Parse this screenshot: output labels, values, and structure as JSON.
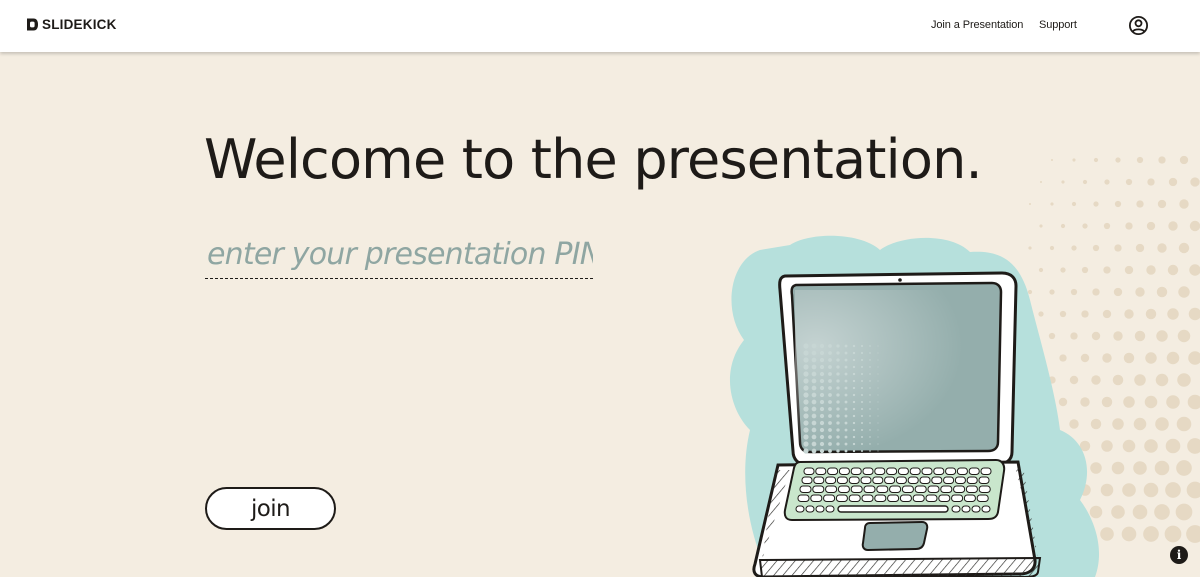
{
  "header": {
    "logo_text": "SLIDEKICK",
    "nav": {
      "join": "Join a Presentation",
      "support": "Support"
    },
    "account_icon": "user-circle-icon"
  },
  "main": {
    "headline": "Welcome to the presentation.",
    "pin_placeholder": "enter your presentation PIN",
    "pin_value": "",
    "join_label": "join"
  },
  "illustration": {
    "icon": "laptop-illustration"
  },
  "info_button": {
    "icon": "info-icon",
    "glyph": "i"
  },
  "colors": {
    "background": "#f4ede1",
    "header_bg": "#ffffff",
    "text": "#1e1b18",
    "placeholder": "#8fa6a2",
    "accent_teal": "#b6e0dc",
    "screen": "#94aeac",
    "keyboard_green": "#c9e6cc"
  }
}
